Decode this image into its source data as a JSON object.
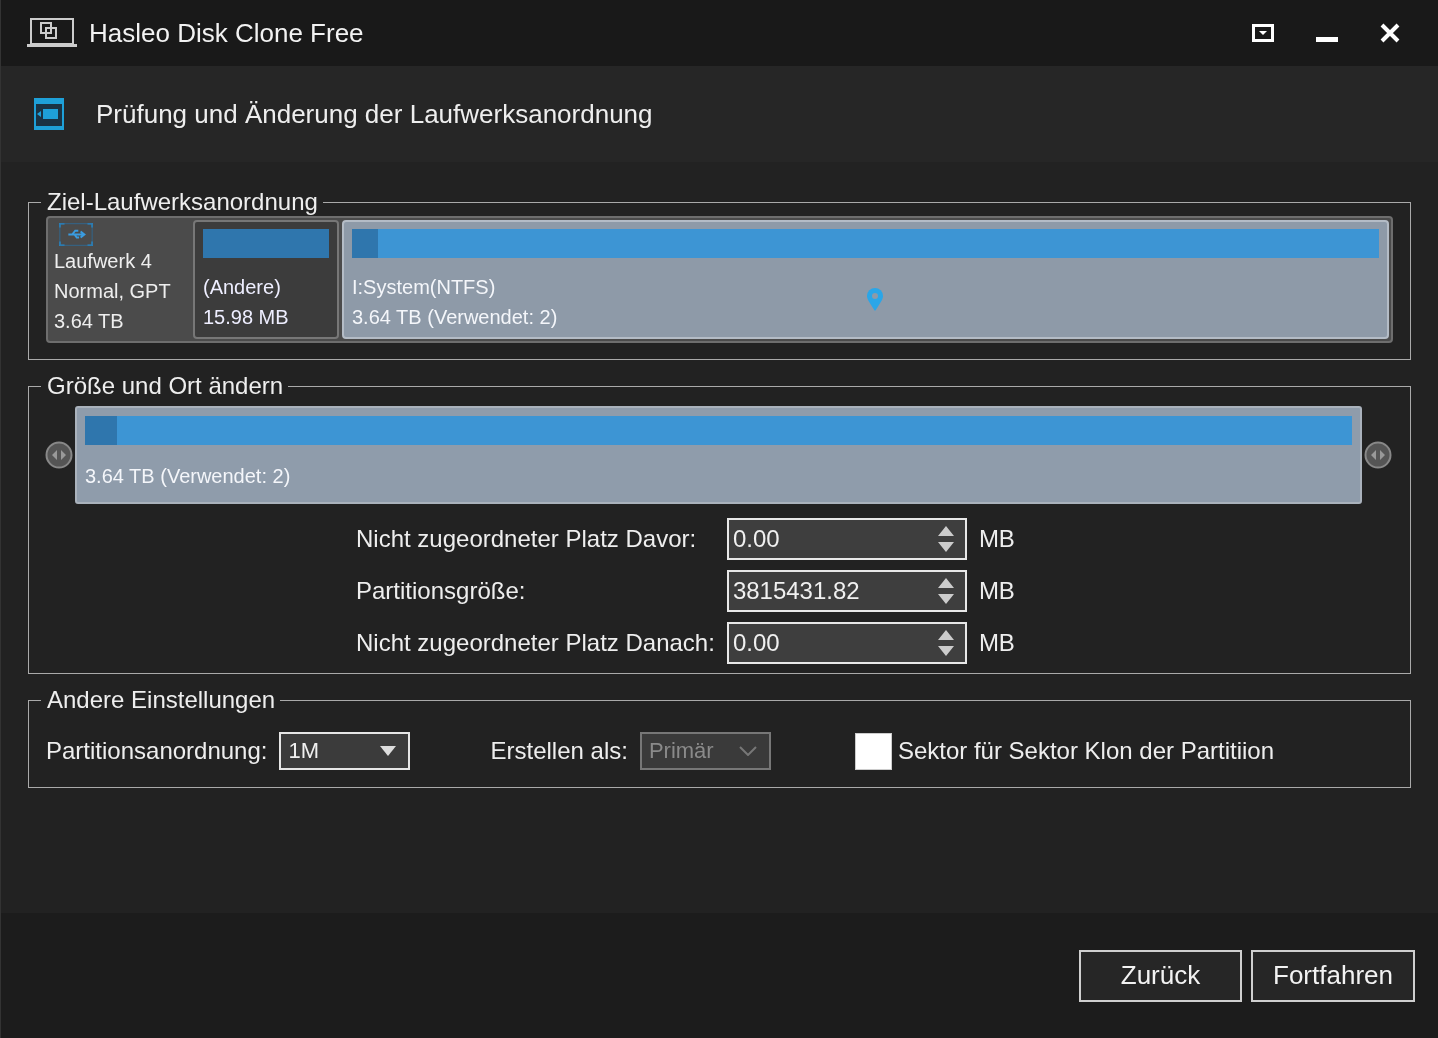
{
  "window": {
    "title": "Hasleo Disk Clone Free"
  },
  "page": {
    "title": "Prüfung und Änderung der Laufwerksanordnung"
  },
  "disk_layout": {
    "legend": "Ziel-Laufwerksanordnung",
    "disk": {
      "name": "Laufwerk 4",
      "type": "Normal, GPT",
      "size": "3.64 TB"
    },
    "partitions": [
      {
        "label": "(Andere)",
        "size": "15.98 MB",
        "level": 1,
        "selected": false
      },
      {
        "label": "I:System(NTFS)",
        "size": "3.64 TB (Verwendet: 2)",
        "level": 0.025,
        "selected": true
      }
    ]
  },
  "resize": {
    "legend": "Größe und Ort ändern",
    "summary": "3.64 TB (Verwendet: 2)",
    "level": 0.025,
    "fields": [
      {
        "label": "Nicht zugeordneter Platz Davor:",
        "value": "0.00",
        "unit": "MB"
      },
      {
        "label": "Partitionsgröße:",
        "value": "3815431.82",
        "unit": "MB"
      },
      {
        "label": "Nicht zugeordneter Platz Danach:",
        "value": "0.00",
        "unit": "MB"
      }
    ]
  },
  "other": {
    "legend": "Andere Einstellungen",
    "fields": [
      {
        "kind": "dropdown",
        "label": "Partitionsanordnung:",
        "value": "1M",
        "disabled": false
      },
      {
        "kind": "dropdown",
        "label": "Erstellen als:",
        "value": "Primär",
        "disabled": true
      },
      {
        "kind": "checkbox",
        "label": "Sektor für Sektor Klon der Partitiion",
        "checked": false
      }
    ]
  },
  "buttons": [
    "Zurück",
    "Fortfahren"
  ]
}
